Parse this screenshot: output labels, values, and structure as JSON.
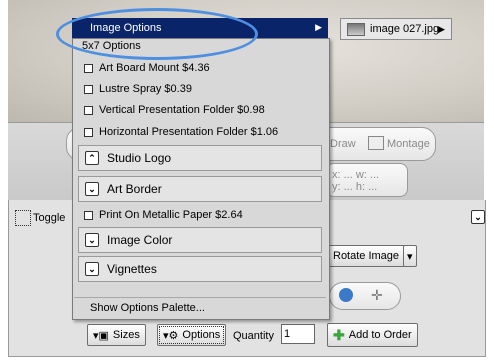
{
  "menu": {
    "header_label": "Image Options",
    "header_arrow": "▶",
    "submenu_label": "image 027.jpg",
    "submenu_arrow": "▶",
    "section_title": "5x7 Options",
    "options": [
      "Art Board Mount $4.36",
      "Lustre Spray $0.39",
      "Vertical Presentation Folder $0.98",
      "Horizontal Presentation Folder $1.06"
    ],
    "sections": {
      "studio_logo": "Studio Logo",
      "art_border": "Art Border",
      "metallic": "Print On Metallic Paper $2.64",
      "image_color": "Image Color",
      "vignettes": "Vignettes"
    },
    "footer": "Show Options Palette..."
  },
  "toolbar": {
    "draw": "Draw",
    "montage": "Montage",
    "xw": "x: ... w: ...",
    "yh": "y: ... h: ..."
  },
  "panel": {
    "toggle": "Toggle",
    "rotate": "Rotate Image",
    "sizes": "Sizes",
    "options": "Options",
    "quantity_label": "Quantity",
    "quantity_value": "1",
    "add_to_order": "Add to Order"
  },
  "icons": {
    "expand": "⌃",
    "collapse": "⌄",
    "dropdown": "▾"
  }
}
